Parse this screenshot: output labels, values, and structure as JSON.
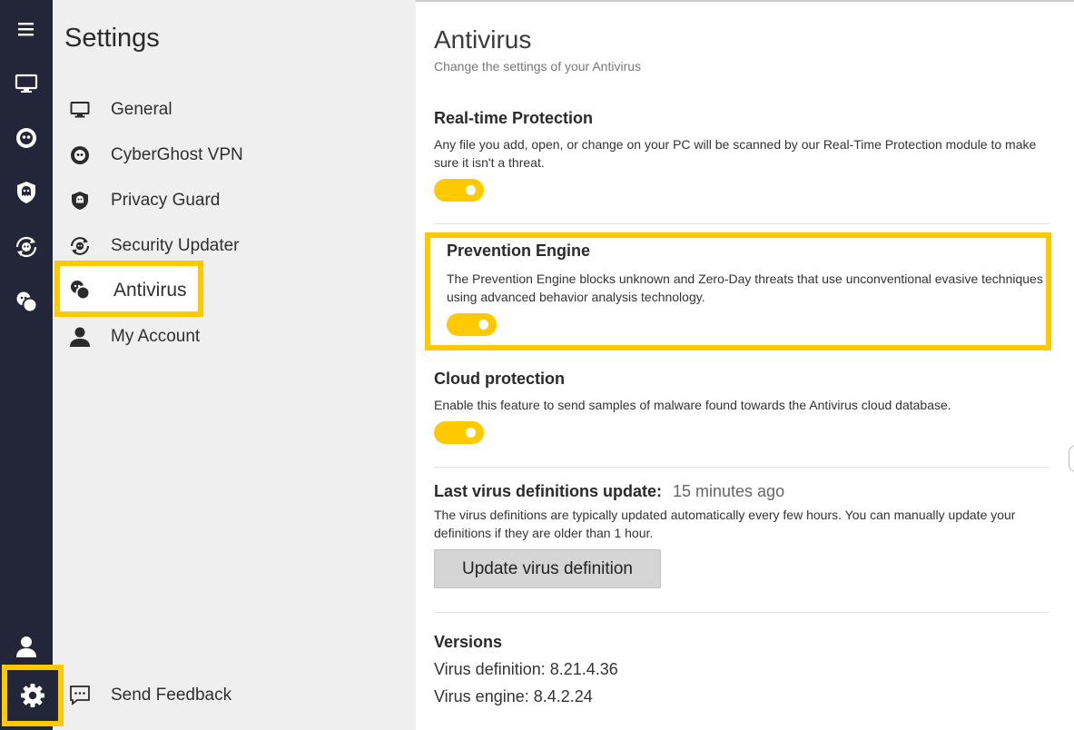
{
  "sidebar": {
    "title": "Settings",
    "items": [
      {
        "label": "General",
        "icon": "monitor-icon"
      },
      {
        "label": "CyberGhost VPN",
        "icon": "ghost-icon"
      },
      {
        "label": "Privacy Guard",
        "icon": "privacy-shield-icon"
      },
      {
        "label": "Security Updater",
        "icon": "security-updater-icon"
      },
      {
        "label": "Antivirus",
        "icon": "antivirus-icon",
        "active": true
      },
      {
        "label": "My Account",
        "icon": "user-icon"
      }
    ],
    "feedback_label": "Send Feedback"
  },
  "main": {
    "title": "Antivirus",
    "subtitle": "Change the settings of your Antivirus",
    "realtime": {
      "title": "Real-time Protection",
      "desc": "Any file you add, open, or change on your PC will be scanned by our Real-Time Protection module to make sure it isn't a threat.",
      "enabled": true
    },
    "prevention": {
      "title": "Prevention Engine",
      "desc": "The Prevention Engine blocks unknown and Zero-Day threats that use unconventional evasive techniques using advanced behavior analysis technology.",
      "enabled": true
    },
    "cloud": {
      "title": "Cloud protection",
      "desc": "Enable this feature to send samples of malware found towards the Antivirus cloud database.",
      "enabled": true
    },
    "definitions": {
      "label": "Last virus definitions update:",
      "value": "15 minutes ago",
      "desc": "The virus definitions are typically updated automatically every few hours. You can manually update your definitions if they are older than 1 hour.",
      "button": "Update virus definition"
    },
    "versions": {
      "title": "Versions",
      "definition": "Virus definition: 8.21.4.36",
      "engine": "Virus engine: 8.4.2.24"
    }
  },
  "colors": {
    "accent": "#FFC900",
    "iconbar": "#232538",
    "sidebar": "#EFEFEF"
  }
}
